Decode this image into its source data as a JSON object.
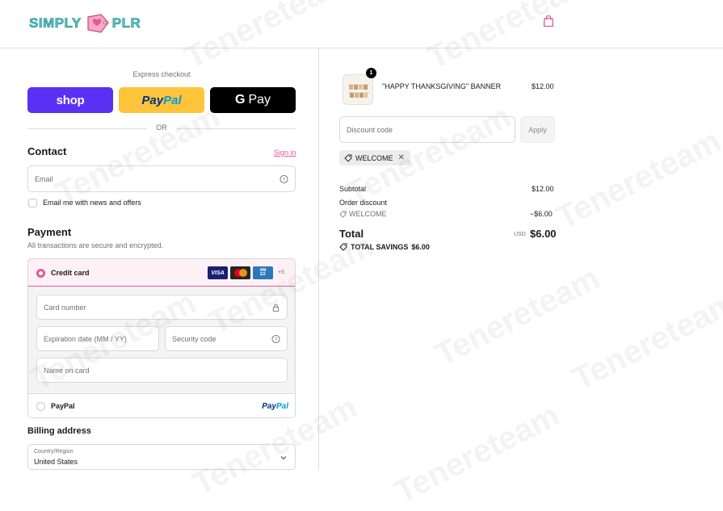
{
  "brand": {
    "logo_left": "SIMPLY",
    "logo_right": "PLR"
  },
  "header": {
    "cart_icon": "shopping-bag-icon"
  },
  "express": {
    "label": "Express checkout",
    "shop_label": "shop",
    "paypal_label_a": "Pay",
    "paypal_label_b": "Pal",
    "gpay_g": "G",
    "gpay_label": "Pay",
    "or_label": "OR"
  },
  "contact": {
    "heading": "Contact",
    "signin_link": "Sign in",
    "email_placeholder": "Email",
    "newsletter_label": "Email me with news and offers"
  },
  "payment": {
    "heading": "Payment",
    "subtitle": "All transactions are secure and encrypted.",
    "credit_card_label": "Credit card",
    "card_brands": {
      "visa": "VISA",
      "amex_a": "AM",
      "amex_b": "EX"
    },
    "more_cards": "+5",
    "card_number_placeholder": "Card number",
    "expiry_placeholder": "Expiration date (MM / YY)",
    "security_placeholder": "Security code",
    "name_placeholder": "Name on card",
    "paypal_label": "PayPal",
    "paypal_logo_a": "Pay",
    "paypal_logo_b": "Pal"
  },
  "billing": {
    "heading": "Billing address",
    "country_label": "Country/Region",
    "country_value": "United States"
  },
  "order": {
    "item_quantity": "1",
    "item_name": "\"HAPPY THANKSGIVING\" BANNER",
    "item_price": "$12.00",
    "discount_placeholder": "Discount code",
    "apply_label": "Apply",
    "applied_code": "WELCOME",
    "subtotal_label": "Subtotal",
    "subtotal_value": "$12.00",
    "order_discount_label": "Order discount",
    "discount_code": "WELCOME",
    "discount_value": "−$6.00",
    "total_label": "Total",
    "currency": "USD",
    "total_value": "$6.00",
    "savings_label": "TOTAL SAVINGS",
    "savings_value": "$6.00"
  },
  "watermark": "Tenereteam",
  "colors": {
    "accent": "#e15a93",
    "shop": "#5a31f4",
    "paypal": "#ffc439",
    "gpay": "#000000"
  }
}
